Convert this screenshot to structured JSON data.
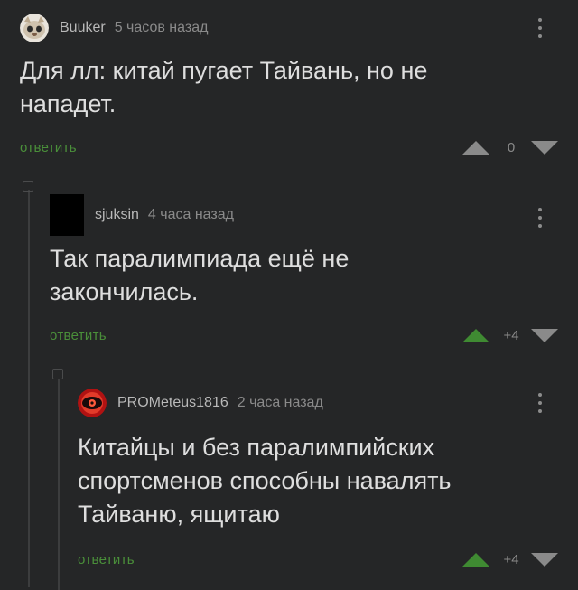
{
  "comments": [
    {
      "author": "Buuker",
      "time": "5 часов назад",
      "text": "Для лл: китай пугает Тайвань, но не нападет.",
      "reply_label": "ответить",
      "score": "0"
    },
    {
      "author": "sjuksin",
      "time": "4 часа назад",
      "text": "Так паралимпиада ещё не закончилась.",
      "reply_label": "ответить",
      "score": "+4"
    },
    {
      "author": "PROMeteus1816",
      "time": "2 часа назад",
      "text": "Китайцы и без паралимпийских спортсменов способны навалять Тайваню, ящитаю",
      "reply_label": "ответить",
      "score": "+4"
    }
  ],
  "colors": {
    "background": "#252627",
    "reply": "#4a8f3a",
    "upvote_active": "#3f8a32",
    "muted": "#8a8a8a"
  },
  "icons": [
    "avatar-cat",
    "avatar-black-square",
    "avatar-red-eye",
    "more-vertical-icon",
    "upvote-icon",
    "downvote-icon"
  ]
}
